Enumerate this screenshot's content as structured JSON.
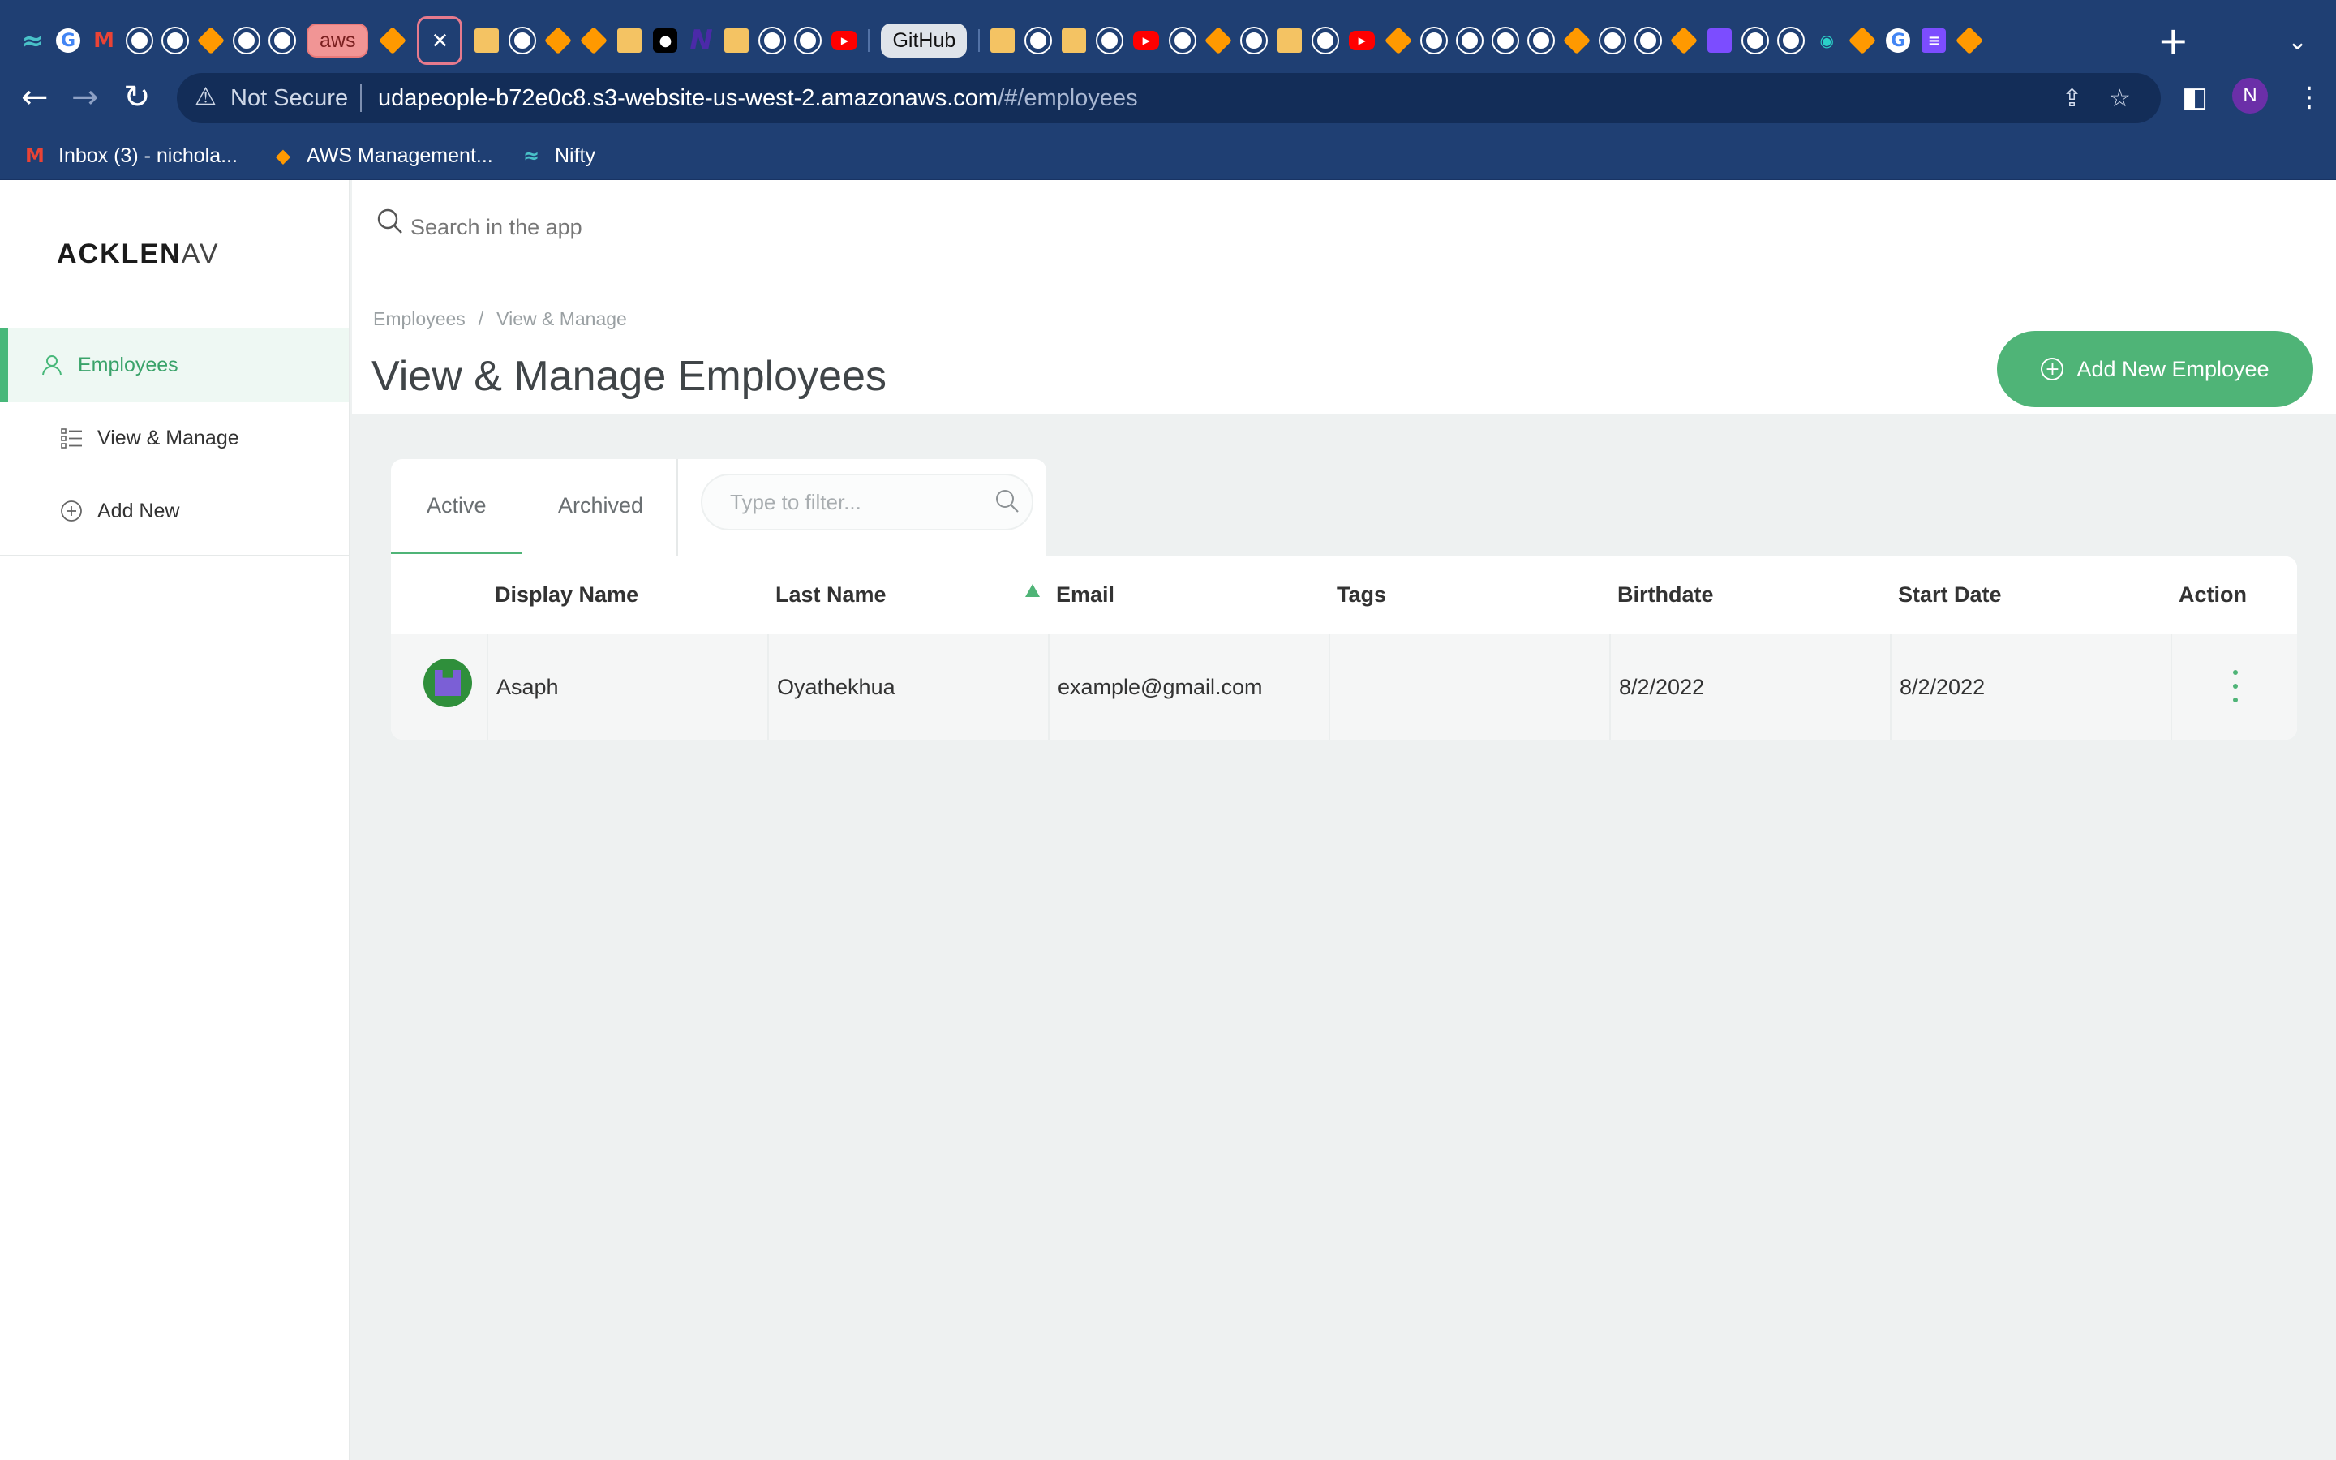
{
  "browser": {
    "tab_chips": {
      "aws": "aws",
      "github": "GitHub"
    },
    "active_tab_close": "×",
    "new_tab": "+",
    "tab_list": "⌄",
    "security_label": "Not Secure",
    "url_host": "udapeople-b72e0c8.s3-website-us-west-2.amazonaws.com",
    "url_path": "/#/employees",
    "profile_initial": "N",
    "bookmarks": [
      {
        "label": "Inbox (3) - nichola...",
        "icon": "gmail-icon"
      },
      {
        "label": "AWS Management...",
        "icon": "aws-icon"
      },
      {
        "label": "Nifty",
        "icon": "nifty-icon"
      }
    ]
  },
  "app": {
    "logo_bold": "ACKLEN",
    "logo_light": "AV",
    "search_placeholder": "Search in the app",
    "sidebar": {
      "items": [
        {
          "label": "Employees",
          "icon": "user-icon"
        },
        {
          "label": "View & Manage",
          "icon": "list-icon"
        },
        {
          "label": "Add New",
          "icon": "plus-circle-icon"
        }
      ]
    },
    "breadcrumb": [
      "Employees",
      "View & Manage"
    ],
    "breadcrumb_sep": "/",
    "page_title": "View & Manage Employees",
    "add_button": "Add New Employee",
    "tabs": [
      "Active",
      "Archived"
    ],
    "filter_placeholder": "Type to filter...",
    "table": {
      "columns": [
        "Display Name",
        "Last Name",
        "Email",
        "Tags",
        "Birthdate",
        "Start Date",
        "Action"
      ],
      "rows": [
        {
          "display_name": "Asaph",
          "last_name": "Oyathekhua",
          "email": "example@gmail.com",
          "tags": "",
          "birthdate": "8/2/2022",
          "start_date": "8/2/2022"
        }
      ]
    }
  },
  "colors": {
    "chrome": "#1f3f73",
    "accent_green": "#4fb477",
    "page_bg": "#eef1f1"
  }
}
